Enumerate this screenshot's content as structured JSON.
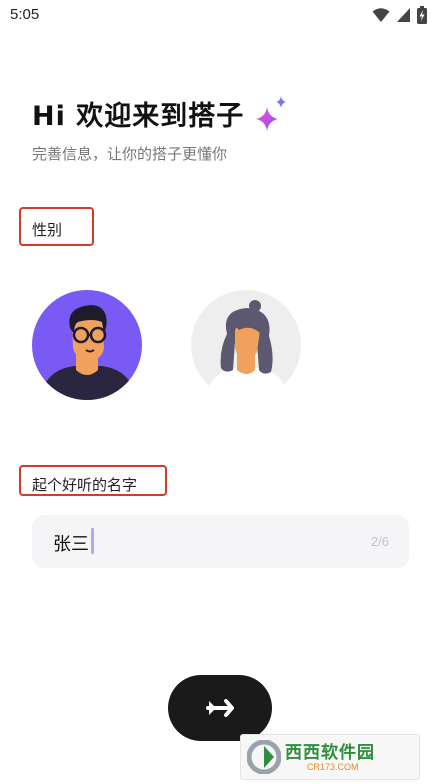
{
  "status_bar": {
    "time": "5:05",
    "icons": [
      "wifi-icon",
      "signal-icon",
      "battery-charging-icon"
    ]
  },
  "header": {
    "title": "Hi 欢迎来到搭子",
    "title_icon": "sparkle-icon",
    "subtitle": "完善信息，让你的搭子更懂你"
  },
  "gender": {
    "label": "性别",
    "options": [
      {
        "name": "male-avatar"
      },
      {
        "name": "female-avatar"
      }
    ]
  },
  "name": {
    "label": "起个好听的名字",
    "value": "张三",
    "counter": "2/6"
  },
  "next_button": {
    "icon": "send-arrow-icon"
  },
  "watermark": {
    "text": "西西软件园",
    "sub": "CR173.COM"
  },
  "colors": {
    "accent_purple": "#7a5af5",
    "caret": "#b9a4f7",
    "annotation_red": "#d23a2a",
    "button_dark": "#1a1a1a"
  }
}
